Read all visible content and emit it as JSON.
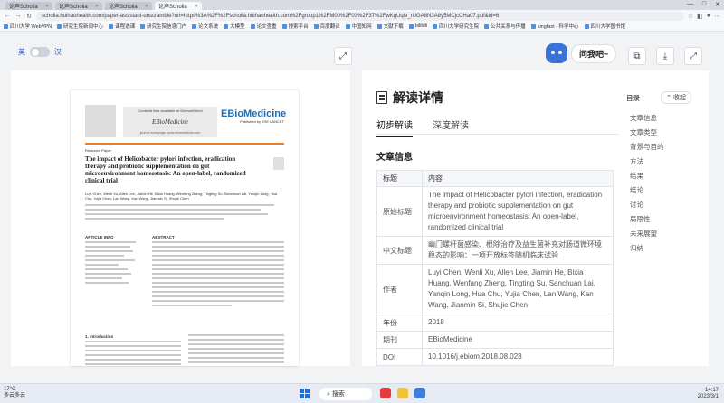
{
  "browser": {
    "tabs": [
      {
        "label": "论声Scholia"
      },
      {
        "label": "论声Scholia"
      },
      {
        "label": "论声Scholia"
      },
      {
        "label": "论声Scholia"
      }
    ],
    "url": "scholia.huihaohealth.com/paper-assistant-unscramble?url=https%3A%2F%2Fscholia.huihaohealth.com%2Fgroup1%2FM00%2F03%2F37%2FwKgUqle_rUGA8N3A8y5MCjcCHa07.pdf&id=6",
    "bookmarks": [
      "四川大学 WebVPN",
      "研究生院新闻中心",
      "课程选课",
      "研究生院信息门户",
      "论文系统",
      "大模型",
      "论文查重",
      "搜索平台",
      "百度翻译",
      "中国知网",
      "文献下载",
      "bilibili",
      "四川大学研究生院",
      "公共关系与传播",
      "kingfast - 科学中心",
      "四川大学图书馆"
    ],
    "win_controls": [
      "—",
      "□",
      "✕"
    ]
  },
  "toolbar": {
    "lang_left": "英",
    "lang_right": "汉",
    "assistant_label": "问我吧~"
  },
  "paper": {
    "journal_top": "Contents lists available at ScienceDirect",
    "journal_name": "EBioMedicine",
    "journal_url": "journal homepage: www.ebiomedicine.com",
    "brand": "EBioMedicine",
    "brand_sub": "Published by THE LANCET",
    "article_type": "Research Paper",
    "title": "The impact of Helicobacter pylori infection, eradication therapy and probiotic supplementation on gut microenvironment homeostasis: An open-label, randomized clinical trial",
    "authors": "Luyi Chen, Wenli Xu, Allen Lee, Jiamin He, Bixia Huang, Wenfang Zheng, Tingting Su, Sanchuan Lai, Yanqin Long, Hua Chu, Yujia Chen, Lan Wang, Kan Wang, Jianmin Si, Shujie Chen",
    "section_info": "ARTICLE INFO",
    "section_abstract": "ABSTRACT",
    "section_intro": "1. Introduction"
  },
  "details": {
    "title": "解读详情",
    "tabs": [
      "初步解读",
      "深度解读"
    ],
    "section": "文章信息",
    "table_head": [
      "标题",
      "内容"
    ],
    "rows": [
      {
        "key": "原始标题",
        "value": "The impact of Helicobacter pylori infection, eradication therapy and probiotic supplementation on gut microenvironment homeostasis: An open-label, randomized clinical trial"
      },
      {
        "key": "中文标题",
        "value": "幽门螺杆菌感染、根除治疗及益生菌补充对肠道微环境稳态的影响：一项开放标签随机临床试验"
      },
      {
        "key": "作者",
        "value": "Luyi Chen, Wenli Xu, Allen Lee, Jiamin He, Bixia Huang, Wenfang Zheng, Tingting Su, Sanchuan Lai, Yanqin Long, Hua Chu, Yujia Chen, Lan Wang, Kan Wang, Jianmin Si, Shujie Chen"
      },
      {
        "key": "年份",
        "value": "2018"
      },
      {
        "key": "期刊",
        "value": "EBioMedicine"
      },
      {
        "key": "DOI",
        "value": "10.1016/j.ebiom.2018.08.028"
      }
    ]
  },
  "toc": {
    "title": "目录",
    "collapse": "收起",
    "items": [
      "文章信息",
      "文章类型",
      "背景与目的",
      "方法",
      "结果",
      "结论",
      "讨论",
      "局限性",
      "未来展望",
      "归纳"
    ]
  },
  "taskbar": {
    "weather_temp": "17°C",
    "weather_desc": "多云多云",
    "search": "搜索",
    "time": "14:17",
    "date": "2023/3/1"
  }
}
